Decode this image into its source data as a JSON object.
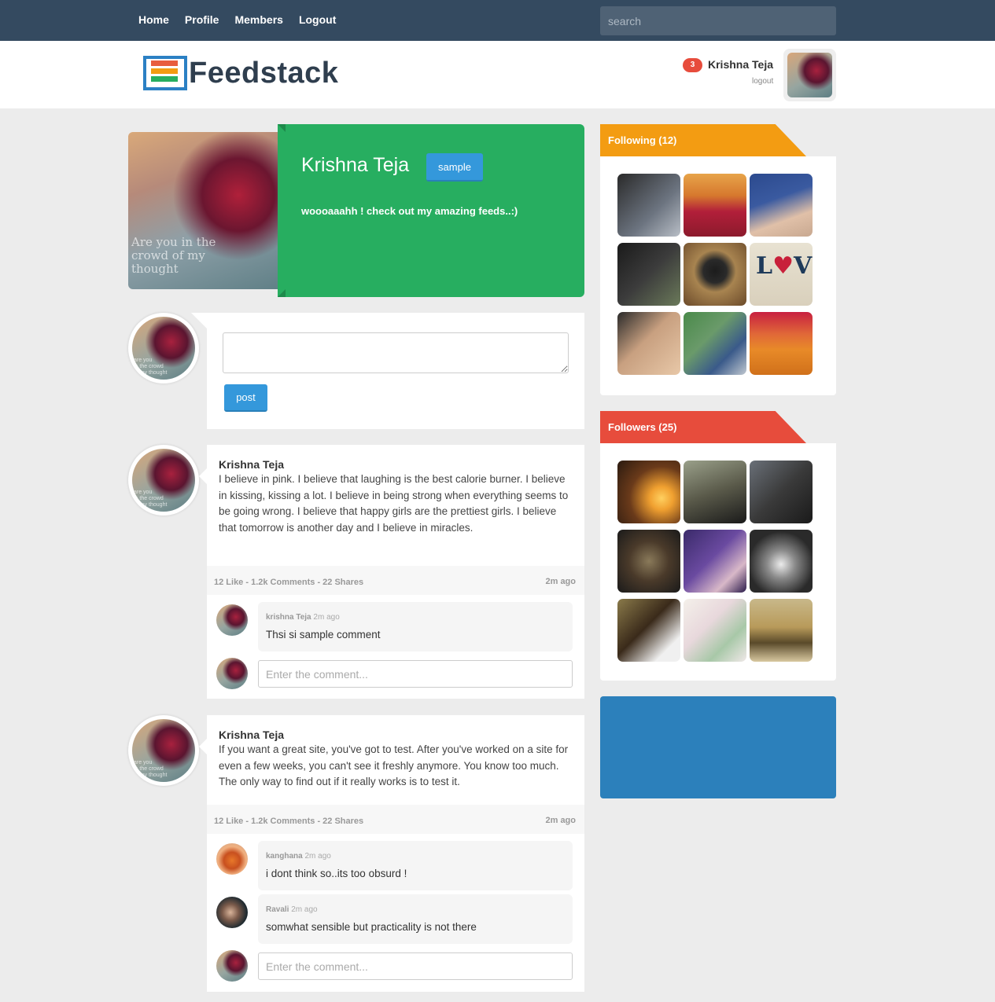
{
  "nav": {
    "links": [
      "Home",
      "Profile",
      "Members",
      "Logout"
    ],
    "search_placeholder": "search"
  },
  "header": {
    "logo_text": "Feedstack",
    "notification_count": "3",
    "user_name": "Krishna Teja",
    "logout_label": "logout"
  },
  "profile": {
    "name": "Krishna Teja",
    "button_label": "sample",
    "bio": "woooaaahh ! check out my amazing feeds..:)",
    "image_caption": "Are you in the crowd of my thought"
  },
  "composer": {
    "post_label": "post"
  },
  "posts": [
    {
      "author": "Krishna Teja",
      "text": "I believe in pink. I believe that laughing is the best calorie burner. I believe in kissing, kissing a lot. I believe in being strong when everything seems to be going wrong. I believe that happy girls are the prettiest girls. I believe that tomorrow is another day and I believe in miracles.",
      "meta": "12 Like - 1.2k Comments - 22 Shares",
      "time": "2m ago",
      "comments": [
        {
          "author": "krishna Teja",
          "time": "2m ago",
          "text": "Thsi si sample comment"
        }
      ],
      "comment_placeholder": "Enter the comment..."
    },
    {
      "author": "Krishna Teja",
      "text": "If you want a great site, you've got to test. After you've worked on a site for even a few weeks, you can't see it freshly anymore. You know too much. The only way to find out if it really works is to test it.",
      "meta": "12 Like - 1.2k Comments - 22 Shares",
      "time": "2m ago",
      "comments": [
        {
          "author": "kanghana",
          "time": "2m ago",
          "text": "i dont think so..its too obsurd !"
        },
        {
          "author": "Ravali",
          "time": "2m ago",
          "text": "somwhat sensible but practicality is not there"
        }
      ],
      "comment_placeholder": "Enter the comment..."
    }
  ],
  "sidebar": {
    "following_title": "Following (12)",
    "followers_title": "Followers (25)",
    "following_color": "#f39c12",
    "followers_color": "#e74c3c",
    "promo_color": "#2c80bb"
  }
}
